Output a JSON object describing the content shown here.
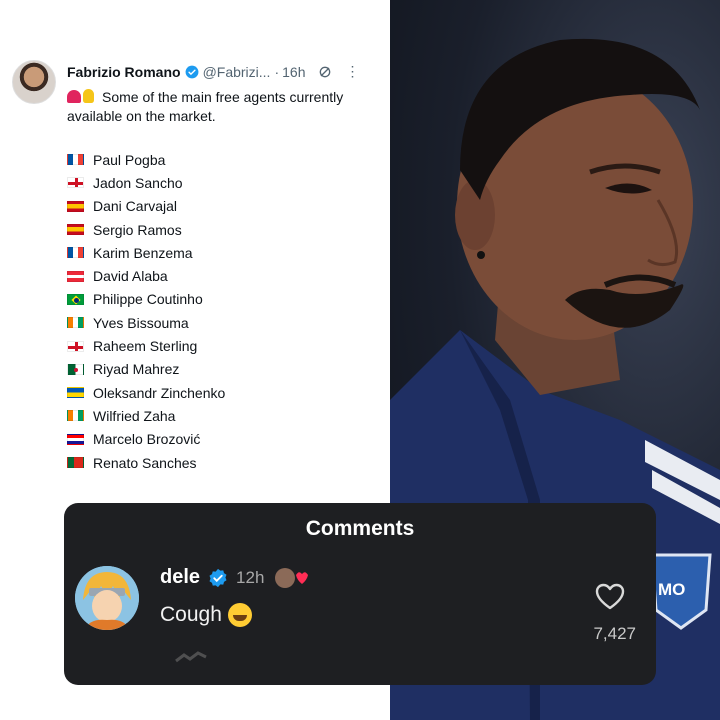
{
  "tweet": {
    "author_name": "Fabrizio Romano",
    "handle": "@Fabrizi...",
    "separator": "·",
    "time": "16h",
    "more_icon": "⋮",
    "text": "Some of the main free agents currently available on the market.",
    "players": [
      {
        "flag": "france",
        "name": "Paul Pogba"
      },
      {
        "flag": "england",
        "name": "Jadon Sancho"
      },
      {
        "flag": "spain",
        "name": "Dani Carvajal"
      },
      {
        "flag": "spain",
        "name": "Sergio Ramos"
      },
      {
        "flag": "france",
        "name": "Karim Benzema"
      },
      {
        "flag": "austria",
        "name": "David Alaba"
      },
      {
        "flag": "brazil",
        "name": "Philippe Coutinho"
      },
      {
        "flag": "ivory-coast",
        "name": "Yves Bissouma"
      },
      {
        "flag": "england",
        "name": "Raheem Sterling"
      },
      {
        "flag": "algeria",
        "name": "Riyad Mahrez"
      },
      {
        "flag": "ukraine",
        "name": "Oleksandr Zinchenko"
      },
      {
        "flag": "ivory-coast",
        "name": "Wilfried Zaha"
      },
      {
        "flag": "croatia",
        "name": "Marcelo Brozović"
      },
      {
        "flag": "portugal",
        "name": "Renato Sanches"
      }
    ]
  },
  "comments": {
    "title": "Comments",
    "username": "dele",
    "time": "12h",
    "text": "Cough",
    "like_count": "7,427"
  },
  "photo": {
    "crest_text": "MO"
  },
  "colors": {
    "verified": "#1d9bf0",
    "comments_bg": "#1e1f22",
    "like_heart": "#e0245e"
  }
}
